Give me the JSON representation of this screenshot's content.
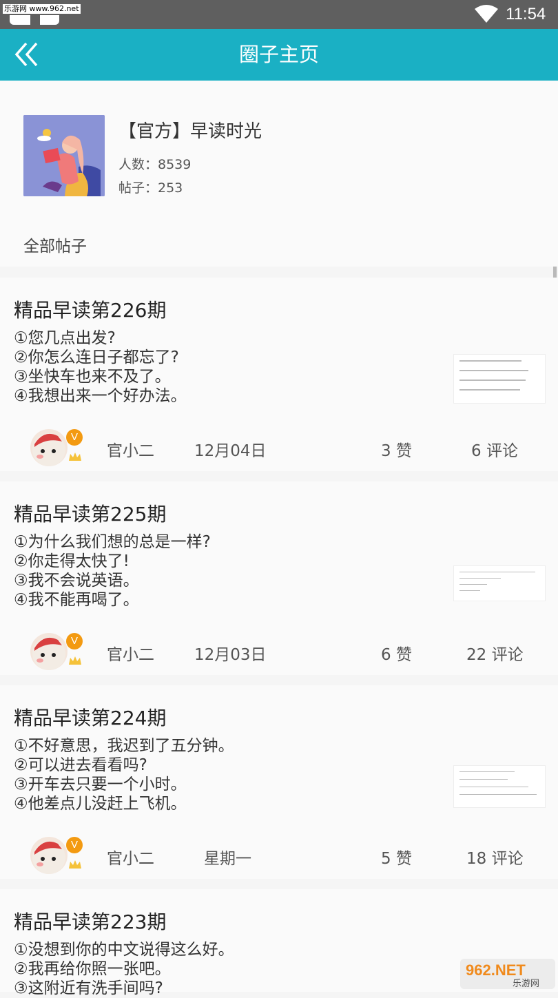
{
  "status_bar": {
    "watermark": "乐游网 www.962.net",
    "time": "11:54"
  },
  "header": {
    "title": "圈子主页",
    "back_icon": "double-chevron-left-icon"
  },
  "circle": {
    "name": "【官方】早读时光",
    "members": "人数：8539",
    "posts": "帖子：253",
    "all_posts_tab": "全部帖子"
  },
  "posts": [
    {
      "title": "精品早读第226期",
      "lines": [
        "①您几点出发?",
        "②你怎么连日子都忘了?",
        "③坐快车也来不及了。",
        "④我想出来一个好办法。"
      ],
      "author": "官小二",
      "date": "12月04日",
      "likes": "3 赞",
      "comments": "6 评论"
    },
    {
      "title": "精品早读第225期",
      "lines": [
        "①为什么我们想的总是一样?",
        "②你走得太快了!",
        "③我不会说英语。",
        "④我不能再喝了。"
      ],
      "author": "官小二",
      "date": "12月03日",
      "likes": "6 赞",
      "comments": "22 评论"
    },
    {
      "title": "精品早读第224期",
      "lines": [
        "①不好意思，我迟到了五分钟。",
        "②可以进去看看吗?",
        "③开车去只要一个小时。",
        "④他差点儿没赶上飞机。"
      ],
      "author": "官小二",
      "date": "星期一",
      "likes": "5 赞",
      "comments": "18 评论"
    },
    {
      "title": "精品早读第223期",
      "lines": [
        "①没想到你的中文说得这么好。",
        "②我再给你照一张吧。",
        "③这附近有洗手间吗?"
      ]
    }
  ],
  "badge_letter": "V",
  "watermark_logo": "962.NET 乐游网",
  "colors": {
    "accent": "#1ab0c4",
    "badge": "#f39a11"
  }
}
